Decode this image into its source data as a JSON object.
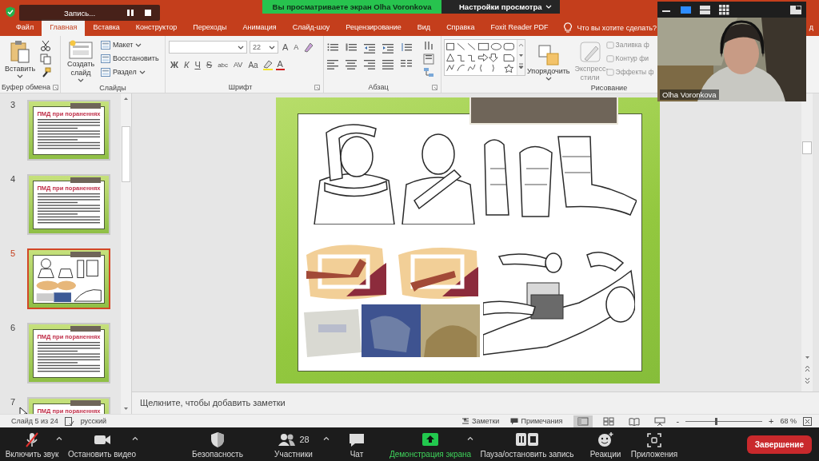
{
  "recording": {
    "label": "Запись..."
  },
  "share_banner": {
    "text": "Вы просматриваете экран Olha Voronkova",
    "options": "Настройки просмотра"
  },
  "tabs": [
    {
      "label": "Файл",
      "selected": false
    },
    {
      "label": "Главная",
      "selected": true
    },
    {
      "label": "Вставка",
      "selected": false
    },
    {
      "label": "Конструктор",
      "selected": false
    },
    {
      "label": "Переходы",
      "selected": false
    },
    {
      "label": "Анимация",
      "selected": false
    },
    {
      "label": "Слайд-шоу",
      "selected": false
    },
    {
      "label": "Рецензирование",
      "selected": false
    },
    {
      "label": "Вид",
      "selected": false
    },
    {
      "label": "Справка",
      "selected": false
    },
    {
      "label": "Foxit Reader PDF",
      "selected": false
    }
  ],
  "tell_me": {
    "placeholder": "Что вы хотите сделать?"
  },
  "tab_partial": "д",
  "clipboard": {
    "paste": "Вставить",
    "group": "Буфер обмена"
  },
  "slides_group": {
    "new_slide": "Создать слайд",
    "layout": "Макет",
    "reset": "Восстановить",
    "section": "Раздел",
    "group": "Слайды"
  },
  "font": {
    "size": "22",
    "grow": "A",
    "shrink": "A",
    "styles": [
      "Ж",
      "К",
      "Ч",
      "S",
      "abc",
      "AV",
      "Aa"
    ],
    "color_button": "A",
    "group": "Шрифт"
  },
  "paragraph": {
    "group": "Абзац"
  },
  "drawing": {
    "arrange": "Упорядочить",
    "quick_styles": {
      "label": "Экспресс-стили",
      "disabled": true
    },
    "format": [
      {
        "label": "Заливка ф",
        "disabled": true
      },
      {
        "label": "Контур фи",
        "disabled": true
      },
      {
        "label": "Эффекты ф",
        "disabled": true
      }
    ],
    "group": "Рисование"
  },
  "video": {
    "name": "Olha Voronkova",
    "view_modes": [
      {
        "kind": "minimize",
        "selected": false
      },
      {
        "kind": "speaker",
        "selected": true
      },
      {
        "kind": "strip",
        "selected": false
      },
      {
        "kind": "gallery",
        "selected": false
      }
    ]
  },
  "thumbnails": [
    {
      "number": "3",
      "kind": "text",
      "title": "ПМД при пораненнях",
      "selected": false
    },
    {
      "number": "4",
      "kind": "text",
      "title": "ПМД при пораненнях",
      "selected": false
    },
    {
      "number": "5",
      "kind": "picture",
      "selected": true
    },
    {
      "number": "6",
      "kind": "text",
      "title": "ПМД при пораненнях",
      "selected": false
    },
    {
      "number": "7",
      "kind": "title_only",
      "title": "ПМД при пораненнях",
      "selected": false
    }
  ],
  "notes": {
    "placeholder": "Щелкните, чтобы добавить заметки"
  },
  "status_bar": {
    "slide": "Слайд 5 из 24",
    "language": "русский",
    "notes": "Заметки",
    "comments": "Примечания",
    "views": [
      {
        "selected": true
      },
      {
        "selected": false
      },
      {
        "selected": false
      },
      {
        "selected": false
      }
    ],
    "zoom": {
      "minus": "-",
      "plus": "+",
      "level": 0.4,
      "reading": "68 %"
    }
  },
  "meeting_controls": [
    {
      "kind": "audio",
      "label": "Включить звук",
      "caret": true,
      "muted": true,
      "active": false
    },
    {
      "kind": "video",
      "label": "Остановить видео",
      "caret": true,
      "active": false
    },
    {
      "kind": "security",
      "label": "Безопасность",
      "caret": false,
      "active": false
    },
    {
      "kind": "participants",
      "label": "Участники",
      "count": "28",
      "caret": true,
      "active": false
    },
    {
      "kind": "chat",
      "label": "Чат",
      "caret": false,
      "active": false
    },
    {
      "kind": "share",
      "label": "Демонстрация экрана",
      "caret": true,
      "active": true
    },
    {
      "kind": "record",
      "label": "Пауза/остановить запись",
      "caret": false,
      "active": false
    },
    {
      "kind": "reactions",
      "label": "Реакции",
      "caret": false,
      "active": false
    },
    {
      "kind": "apps",
      "label": "Приложения",
      "caret": false,
      "active": false
    }
  ],
  "end_button": "Завершение"
}
